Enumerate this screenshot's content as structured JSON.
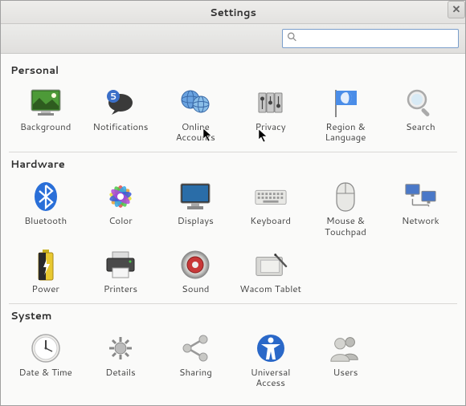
{
  "window": {
    "title": "Settings"
  },
  "search": {
    "placeholder": ""
  },
  "sections": {
    "personal": {
      "title": "Personal"
    },
    "hardware": {
      "title": "Hardware"
    },
    "system": {
      "title": "System"
    }
  },
  "items": {
    "background": {
      "label": "Background"
    },
    "notifications": {
      "label": "Notifications"
    },
    "online": {
      "label": "Online Accounts"
    },
    "privacy": {
      "label": "Privacy"
    },
    "region": {
      "label": "Region & Language"
    },
    "search": {
      "label": "Search"
    },
    "bluetooth": {
      "label": "Bluetooth"
    },
    "color": {
      "label": "Color"
    },
    "displays": {
      "label": "Displays"
    },
    "keyboard": {
      "label": "Keyboard"
    },
    "mouse": {
      "label": "Mouse & Touchpad"
    },
    "network": {
      "label": "Network"
    },
    "power": {
      "label": "Power"
    },
    "printers": {
      "label": "Printers"
    },
    "sound": {
      "label": "Sound"
    },
    "wacom": {
      "label": "Wacom Tablet"
    },
    "datetime": {
      "label": "Date & Time"
    },
    "details": {
      "label": "Details"
    },
    "sharing": {
      "label": "Sharing"
    },
    "universal": {
      "label": "Universal Access"
    },
    "users": {
      "label": "Users"
    }
  }
}
